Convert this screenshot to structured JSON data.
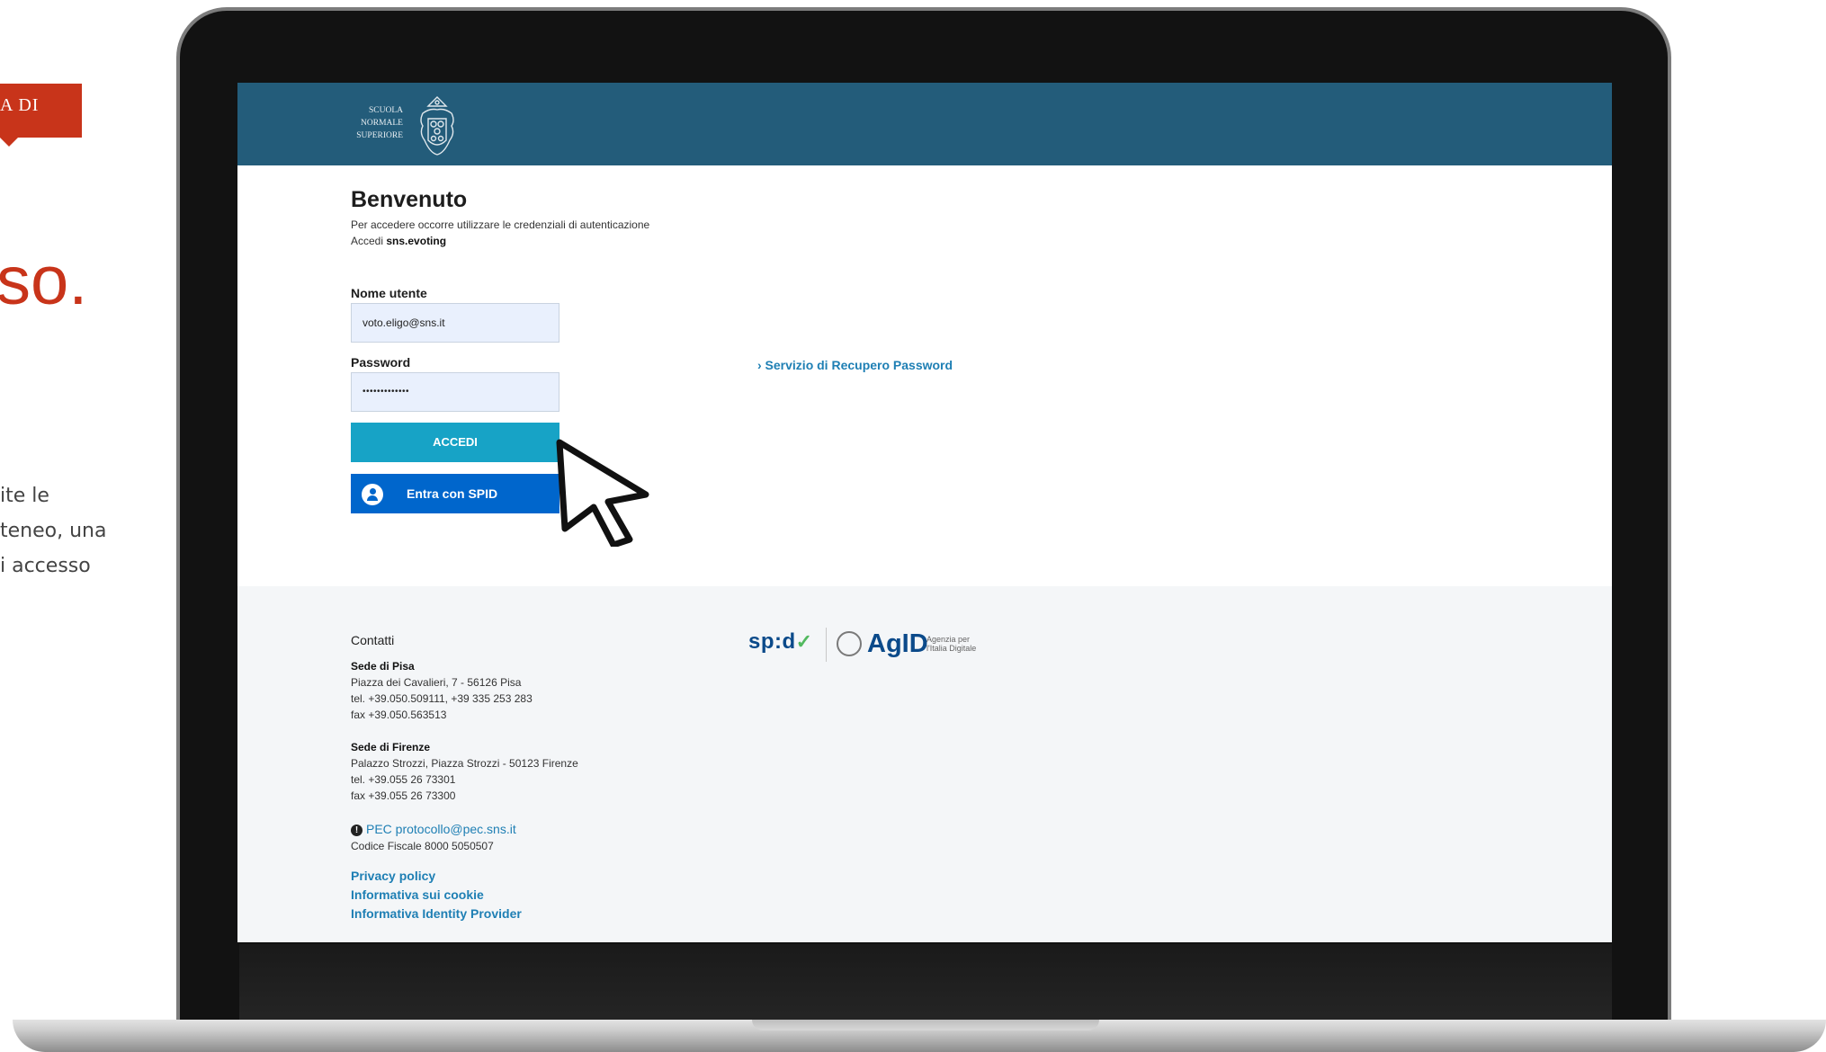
{
  "slide": {
    "tag": "A DI",
    "title": "so.",
    "description_lines": [
      "ite le",
      "teneo, una",
      "i accesso"
    ]
  },
  "header": {
    "logo_lines": [
      "SCUOLA",
      "NORMALE",
      "SUPERIORE"
    ]
  },
  "login": {
    "title": "Benvenuto",
    "subtitle": "Per accedere occorre utilizzare le credenziali di autenticazione",
    "access_prefix": "Accedi",
    "access_service": "sns.evoting",
    "username_label": "Nome utente",
    "username_value": "voto.eligo@sns.it",
    "password_label": "Password",
    "password_value": "•••••••••••••",
    "submit_label": "ACCEDI",
    "spid_label": "Entra con SPID",
    "recover_link": "› Servizio di Recupero Password"
  },
  "footer": {
    "contacts_heading": "Contatti",
    "pisa": {
      "title": "Sede di Pisa",
      "address": "Piazza dei Cavalieri, 7 - 56126 Pisa",
      "tel": "tel. +39.050.509111, +39 335 253 283",
      "fax": "fax +39.050.563513"
    },
    "firenze": {
      "title": "Sede di Firenze",
      "address": "Palazzo Strozzi, Piazza Strozzi - 50123 Firenze",
      "tel": "tel. +39.055 26 73301",
      "fax": "fax +39.055 26 73300"
    },
    "pec": "PEC protocollo@pec.sns.it",
    "codice_fiscale": "Codice Fiscale 8000 5050507",
    "links": [
      "Privacy policy",
      "Informativa sui cookie",
      "Informativa Identity Provider"
    ],
    "spid_logo": "sp:d",
    "agid_logo": "AgID",
    "agid_sub": [
      "Agenzia per",
      "l'Italia Digitale"
    ]
  },
  "colors": {
    "accent_red": "#c8341a",
    "header_teal": "#235c7a",
    "accedi_button": "#17a3c6",
    "spid_button": "#0066cc",
    "link_blue": "#1e7fb4"
  },
  "icons": [
    "spid-user-icon",
    "pec-info-icon",
    "mouse-pointer-icon",
    "crest-logo-icon"
  ]
}
